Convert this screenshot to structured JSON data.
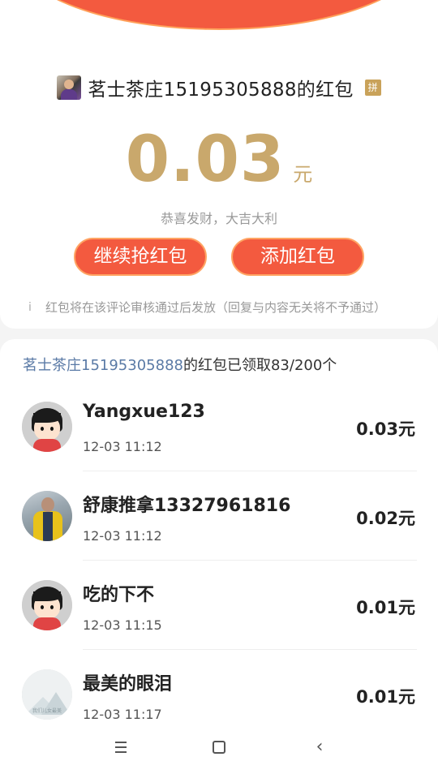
{
  "header": {
    "sender_title": "茗士茶庄15195305888的红包",
    "pin_badge": "拼"
  },
  "envelope": {
    "amount": "0.03",
    "unit": "元",
    "blessing": "恭喜发财，大吉大利",
    "continue_button": "继续抢红包",
    "add_button": "添加红包",
    "notice_icon": "i",
    "notice_text": "红包将在该评论审核通过后发放（回复与内容无关将不予通过）"
  },
  "summary": {
    "sender_name": "茗士茶庄15195305888",
    "status_text": "的红包已领取83/200个"
  },
  "recipients": [
    {
      "name": "Yangxue123",
      "time": "12-03 11:12",
      "amount": "0.03元",
      "avatar": "cartoon-avatar"
    },
    {
      "name": "舒康推拿13327961816",
      "time": "12-03 11:12",
      "amount": "0.02元",
      "avatar": "photo-avatar"
    },
    {
      "name": "吃的下不",
      "time": "12-03 11:15",
      "amount": "0.01元",
      "avatar": "cartoon-avatar"
    },
    {
      "name": "最美的眼泪",
      "time": "12-03 11:17",
      "amount": "0.01元",
      "avatar": "placeholder-avatar",
      "avatar_caption": "我们儿女最美"
    }
  ],
  "nav": {
    "menu_icon": "menu-icon",
    "home_icon": "home-icon",
    "back_icon": "back-icon"
  },
  "colors": {
    "accent_red": "#f35a3f",
    "gold": "#c9a86c",
    "link_blue": "#5a7aa6"
  }
}
